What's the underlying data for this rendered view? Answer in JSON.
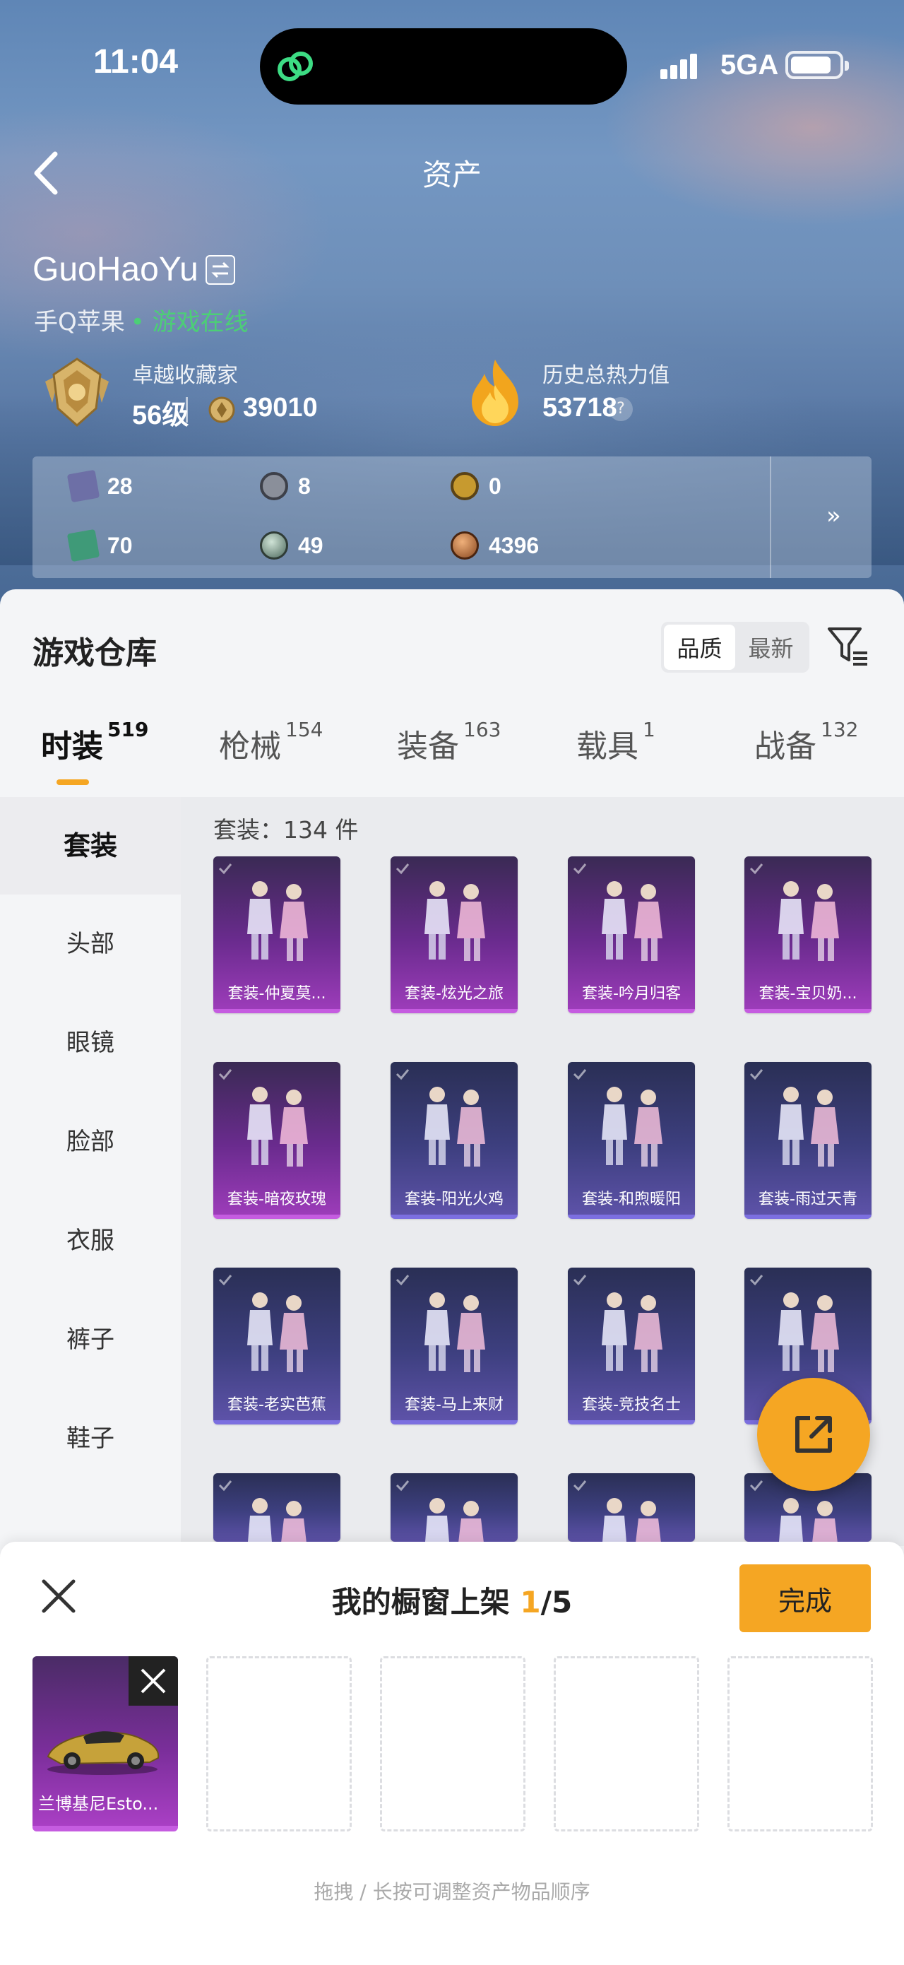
{
  "status_bar": {
    "time": "11:04",
    "network": "5GA"
  },
  "nav": {
    "title": "资产"
  },
  "profile": {
    "username": "GuoHaoYu",
    "platform": "手Q苹果",
    "presence": "• 游戏在线",
    "collector": {
      "label": "卓越收藏家",
      "level": "56级",
      "points": "39010"
    },
    "heat": {
      "label": "历史总热力值",
      "value": "53718",
      "help": "?"
    }
  },
  "resources": [
    {
      "value": "28",
      "icon": "card-icon",
      "color": "#6d6fa6"
    },
    {
      "value": "8",
      "icon": "silver-coin-icon",
      "color": "#8a8f9a"
    },
    {
      "value": "0",
      "icon": "gold-coin-icon",
      "color": "#c79a2f"
    },
    {
      "value": "70",
      "icon": "green-card-icon",
      "color": "#3f9a78"
    },
    {
      "value": "49",
      "icon": "pearl-icon",
      "color": "#6f8a7e"
    },
    {
      "value": "4396",
      "icon": "copper-coin-icon",
      "color": "#b06a3a"
    }
  ],
  "resources_more": "»",
  "warehouse": {
    "title": "游戏仓库",
    "sort_options": [
      "品质",
      "最新"
    ],
    "tabs": [
      {
        "label": "时装",
        "count": "519"
      },
      {
        "label": "枪械",
        "count": "154"
      },
      {
        "label": "装备",
        "count": "163"
      },
      {
        "label": "载具",
        "count": "1"
      },
      {
        "label": "战备",
        "count": "132"
      }
    ],
    "categories": [
      "套装",
      "头部",
      "眼镜",
      "脸部",
      "衣服",
      "裤子",
      "鞋子"
    ],
    "count_text": "套装：134 件",
    "items": [
      {
        "label": "套装-仲夏莫...",
        "rarity": "purple"
      },
      {
        "label": "套装-炫光之旅",
        "rarity": "purple"
      },
      {
        "label": "套装-吟月归客",
        "rarity": "purple"
      },
      {
        "label": "套装-宝贝奶...",
        "rarity": "purple"
      },
      {
        "label": "套装-暗夜玫瑰",
        "rarity": "purple"
      },
      {
        "label": "套装-阳光火鸡",
        "rarity": "blue"
      },
      {
        "label": "套装-和煦暖阳",
        "rarity": "blue"
      },
      {
        "label": "套装-雨过天青",
        "rarity": "blue"
      },
      {
        "label": "套装-老实芭蕉",
        "rarity": "blue"
      },
      {
        "label": "套装-马上来财",
        "rarity": "blue"
      },
      {
        "label": "套装-竞技名士",
        "rarity": "blue"
      },
      {
        "label": "套装-",
        "rarity": "blue"
      },
      {
        "label": "",
        "rarity": "blue"
      },
      {
        "label": "",
        "rarity": "blue"
      },
      {
        "label": "",
        "rarity": "blue"
      },
      {
        "label": "",
        "rarity": "blue"
      }
    ]
  },
  "showcase": {
    "title_prefix": "我的橱窗上架 ",
    "current": "1",
    "total": "/5",
    "done_label": "完成",
    "slots": [
      {
        "label": "兰博基尼Esto..."
      }
    ],
    "hint": "拖拽 / 长按可调整资产物品顺序"
  }
}
